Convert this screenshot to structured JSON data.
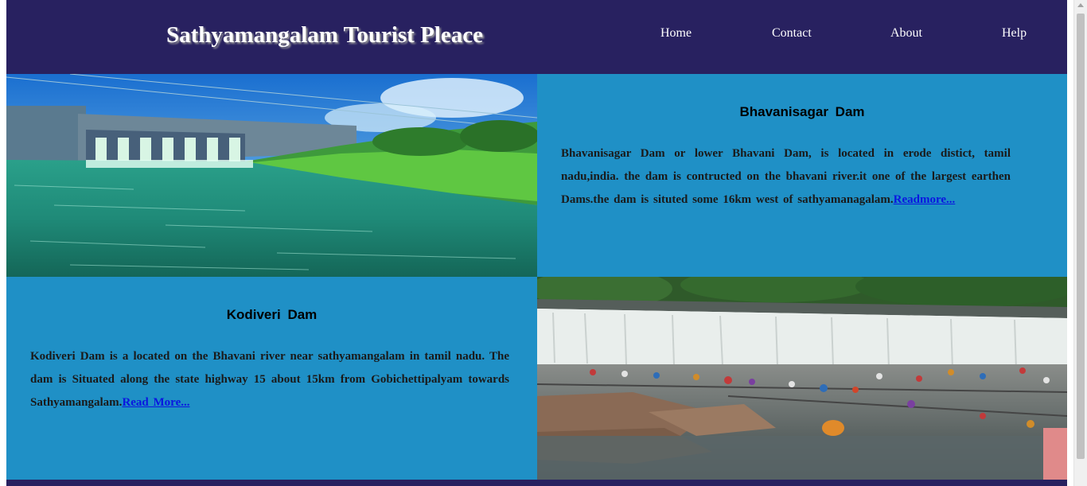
{
  "header": {
    "site_title": "Sathyamangalam Tourist Pleace",
    "nav": [
      "Home",
      "Contact",
      "About",
      "Help"
    ]
  },
  "places": [
    {
      "title": "Bhavanisagar  Dam",
      "description": "Bhavanisagar Dam or lower Bhavani Dam, is located in erode distict, tamil nadu,india. the dam is contructed on the bhavani river.it one of the largest earthen Dams.the dam is situted some 16km west of sathyamanagalam.",
      "link_text": "Readmore..."
    },
    {
      "title": "Kodiveri  Dam",
      "description": "Kodiveri Dam is a located on the Bhavani river near sathyamangalam in tamil nadu. The dam is Situated along the state highway 15 about 15km from Gobichettipalyam towards Sathyamangalam.",
      "link_text": "Read  More..."
    }
  ],
  "colors": {
    "header_bg": "#282160",
    "panel_bg": "#1f90c6",
    "link": "#0a16e0"
  }
}
